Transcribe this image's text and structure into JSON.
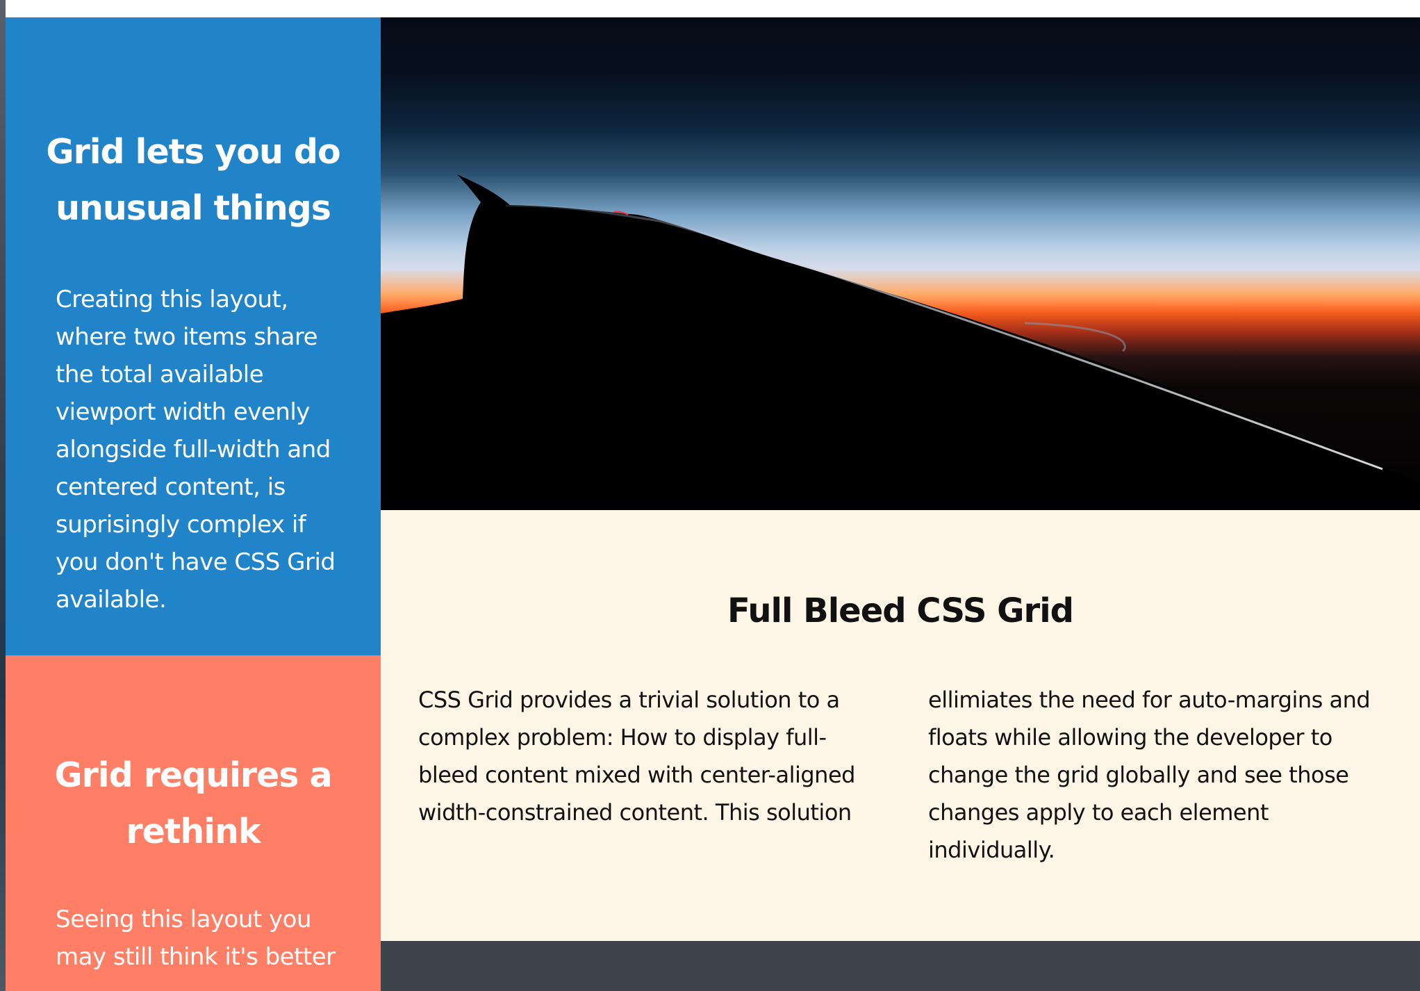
{
  "sidebar": {
    "sections": [
      {
        "title": "Grid lets you do unusual things",
        "text": "Creating this layout, where two items share the total available viewport width evenly alongside full-width and centered content, is suprisingly complex if you don't have CSS Grid available."
      },
      {
        "title": "Grid requires a rethink",
        "text": "Seeing this layout you may still think it's better"
      }
    ]
  },
  "hero": {
    "image_name": "sunset-airplane-wing-image"
  },
  "article": {
    "title": "Full Bleed CSS Grid",
    "columns": [
      "CSS Grid provides a trivial solution to a complex problem: How to display full-bleed content mixed with center-aligned width-constrained content. This solution",
      "ellimiates the need for auto-margins and floats while allowing the developer to change the grid globally and see those changes apply to each element individually."
    ]
  },
  "colors": {
    "blue_panel": "#2284c8",
    "coral_panel": "#ff7f66",
    "article_background": "#fdf5e6",
    "footer_band": "#3f444c"
  }
}
